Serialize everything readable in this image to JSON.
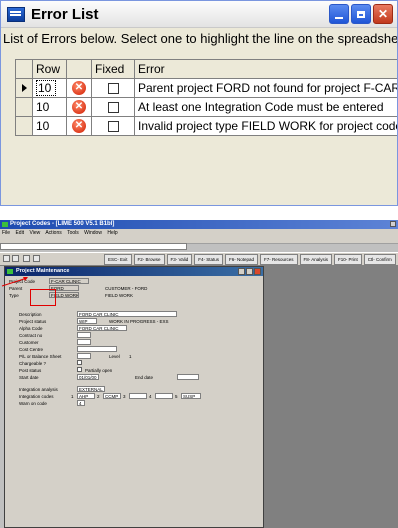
{
  "error_list": {
    "title": "Error List",
    "message": "List of Errors below.  Select one to highlight the line on the spreadsheet",
    "columns": {
      "row": "Row",
      "fixed": "Fixed",
      "error": "Error"
    },
    "rows": [
      {
        "row": "10",
        "fixed": false,
        "error": "Parent project FORD not found for project F-CAR"
      },
      {
        "row": "10",
        "fixed": false,
        "error": "At least one Integration Code must be entered"
      },
      {
        "row": "10",
        "fixed": false,
        "error": "Invalid project type FIELD WORK for project code"
      }
    ]
  },
  "app": {
    "title": "Project Codes - [LIME 500 V5.1 B1bl]",
    "menu": [
      "File",
      "Edit",
      "View",
      "Actions",
      "Tools",
      "Window",
      "Help"
    ],
    "function_keys": [
      "ESC- Exit",
      "F2- Browse",
      "F3- Valid",
      "F4- Status",
      "F6- Notepad",
      "F7- Resources",
      "F8- Analysis",
      "F10- Print",
      "Ctl- Confirm"
    ]
  },
  "maintenance": {
    "title": "Project Maintenance",
    "header": {
      "project_code_label": "Project Code",
      "project_code": "F-CAR CLINIC",
      "parent_label": "Parent",
      "parent": "FORD",
      "parent_desc": "CUSTOMER - FORD",
      "type_label": "Type",
      "type": "FIELD WORK",
      "type_desc": "FIELD WORK"
    },
    "fields": {
      "description_label": "Description",
      "description": "FORD CAR CLINIC",
      "status_label": "Project status",
      "status": "WIP",
      "status_desc": "WORK IN PROGRESS - EXS",
      "alpha_label": "Alpha Code",
      "alpha": "FORD CAR CLINIC",
      "contract_label": "Contract no",
      "customer_label": "Customer",
      "cost_centre_label": "Cost Centre",
      "pl_label": "P/L or Balance Sheet",
      "level_label": "Level",
      "level": "1",
      "chargeable_label": "Chargeable ?",
      "post_status_label": "Post status",
      "post_status": "Partially open",
      "start_label": "Start date",
      "start": "01/01/00",
      "end_label": "End date",
      "integration_label": "Integration analysis",
      "integration": "EXTERNAL",
      "codes_label": "Integration codes",
      "code1_num": "1",
      "code1": "AHP",
      "code2_num": "2",
      "code2": "CCMP",
      "code3_num": "3",
      "code4_num": "4",
      "code5_num": "5",
      "code5": "SUSP",
      "warn_label": "Warn on code",
      "warn": "4"
    }
  }
}
